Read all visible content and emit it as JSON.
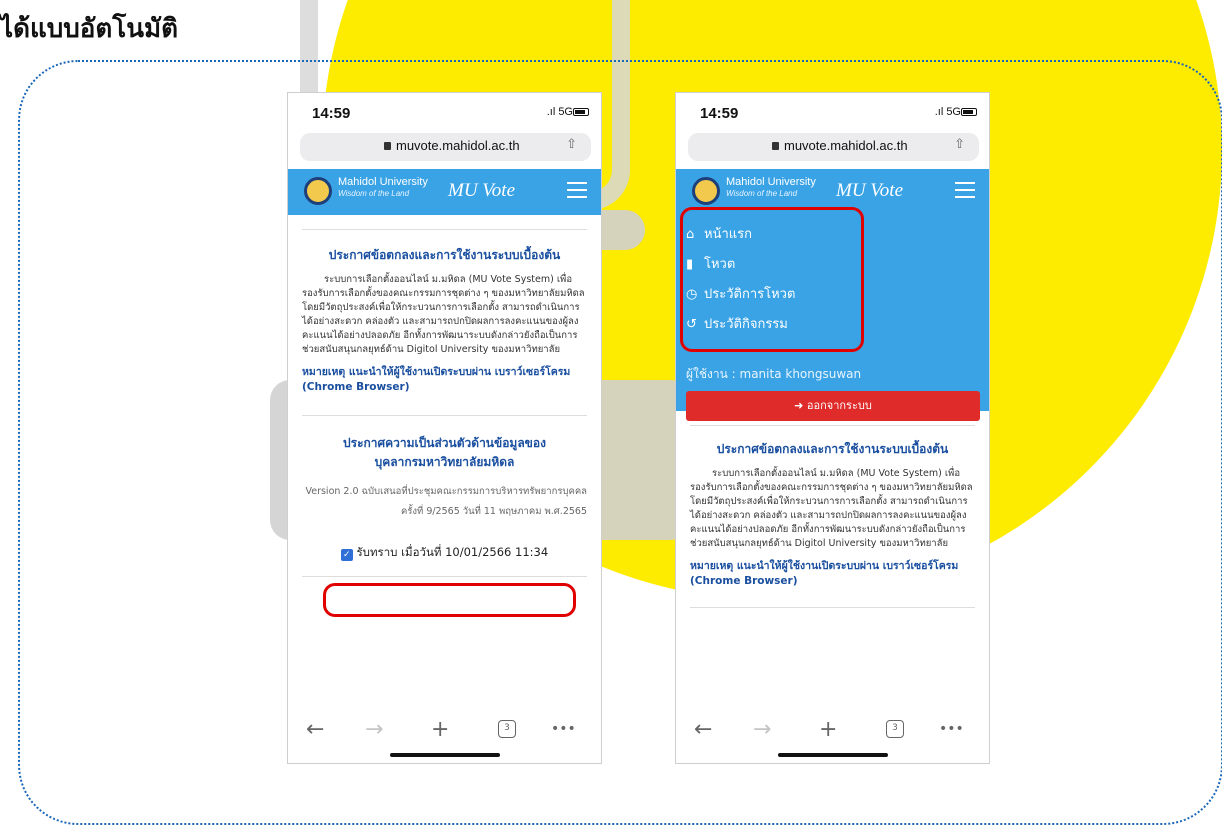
{
  "slide": {
    "title": "ได้แบบอัตโนมัติ",
    "accent_yellow": "#fdeb00",
    "frame_color": "#1a66b8"
  },
  "left_phone": {
    "status_time": "14:59",
    "status_signal": ".ıl 5G",
    "url": "muvote.mahidol.ac.th",
    "brand_name": "Mahidol University",
    "brand_tagline": "Wisdom of the Land",
    "app_title": "MU Vote",
    "terms_title": "ประกาศข้อตกลงและการใช้งานระบบเบื้องต้น",
    "terms_body": "ระบบการเลือกตั้งออนไลน์ ม.มหิดล (MU Vote System) เพื่อรองรับการเลือกตั้งของคณะกรรมการชุดต่าง ๆ ของมหาวิทยาลัยมหิดล โดยมีวัตถุประสงค์เพื่อให้กระบวนการการเลือกตั้ง สามารถดำเนินการได้อย่างสะดวก คล่องตัว และสามารถปกปิดผลการลงคะแนนของผู้ลงคะแนนได้อย่างปลอดภัย อีกทั้งการพัฒนาระบบดังกล่าวยังถือเป็นการช่วยสนับสนุนกลยุทธ์ด้าน Digitol University ของมหาวิทยาลัย",
    "note": "หมายเหตุ แนะนำให้ผู้ใช้งานเปิดระบบผ่าน เบราว์เซอร์โครม (Chrome Browser)",
    "privacy_title": "ประกาศความเป็นส่วนตัวด้านข้อมูลของ บุคลากรมหาวิทยาลัยมหิดล",
    "privacy_version": "Version 2.0 ฉบับเสนอที่ประชุมคณะกรรมการบริหารทรัพยากรบุคคล ครั้งที่ 9/2565 วันที่ 11 พฤษภาคม พ.ศ.2565",
    "acknowledge": "รับทราบ เมื่อวันที่ 10/01/2566 11:34",
    "tabs_count": "3"
  },
  "right_phone": {
    "status_time": "14:59",
    "status_signal": ".ıl 5G",
    "url": "muvote.mahidol.ac.th",
    "brand_name": "Mahidol University",
    "brand_tagline": "Wisdom of the Land",
    "app_title": "MU Vote",
    "menu": [
      {
        "label": "หน้าแรก",
        "icon": "home-icon"
      },
      {
        "label": "โหวต",
        "icon": "chart-icon"
      },
      {
        "label": "ประวัติการโหวต",
        "icon": "clock-icon"
      },
      {
        "label": "ประวัติกิจกรรม",
        "icon": "history-icon"
      }
    ],
    "user_label": "ผู้ใช้งาน : manita khongsuwan",
    "logout_label": "ออกจากระบบ",
    "terms_title": "ประกาศข้อตกลงและการใช้งานระบบเบื้องต้น",
    "terms_body": "ระบบการเลือกตั้งออนไลน์ ม.มหิดล (MU Vote System) เพื่อรองรับการเลือกตั้งของคณะกรรมการชุดต่าง ๆ ของมหาวิทยาลัยมหิดล โดยมีวัตถุประสงค์เพื่อให้กระบวนการการเลือกตั้ง สามารถดำเนินการได้อย่างสะดวก คล่องตัว และสามารถปกปิดผลการลงคะแนนของผู้ลงคะแนนได้อย่างปลอดภัย อีกทั้งการพัฒนาระบบดังกล่าวยังถือเป็นการช่วยสนับสนุนกลยุทธ์ด้าน Digitol University ของมหาวิทยาลัย",
    "note": "หมายเหตุ แนะนำให้ผู้ใช้งานเปิดระบบผ่าน เบราว์เซอร์โครม (Chrome Browser)",
    "tabs_count": "3"
  }
}
